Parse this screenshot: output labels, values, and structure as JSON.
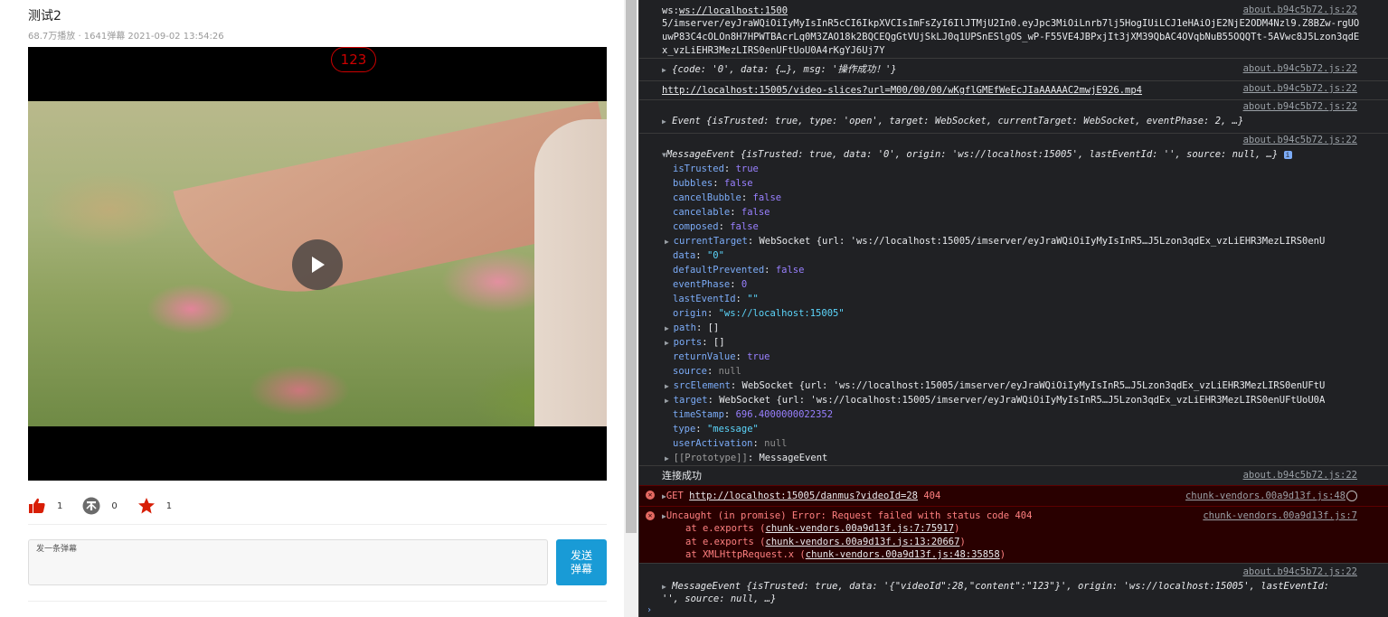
{
  "video_page": {
    "title": "测试2",
    "meta": "68.7万播放 · 1641弹幕 2021-09-02 13:54:26",
    "danmu_text": "123",
    "actions": {
      "like_count": "1",
      "dislike_count": "0",
      "star_count": "1"
    },
    "danmu_input": {
      "placeholder": "发一条弹幕"
    },
    "send_label": "发送\n弹幕"
  },
  "console": {
    "ws_url_line1": "ws://localhost:1500",
    "ws_url_rest": "5/imserver/eyJraWQiOiIyMyIsInR5cCI6IkpXVCIsImFsZyI6IlJTMjU2In0.eyJpc3MiOiLnrb7lj5HogIUiLCJ1eHAiOjE2NjE2ODM4Nzl9.Z8BZw-rgUOuwP83C4cOLOn8H7HPWTBAcrLq0M3ZAO18k2BQCEQgGtVUjSkLJ0q1UPSnESlgOS_wP-F55VE4JBPxjIt3jXM39QbAC4OVqbNuB55OQQTt-5AVwc8J5Lzon3qdEx_vzLiEHR3MezLIRS0enUFtUoU0A4rKgYJ6Uj7Y",
    "ws_source": "about.b94c5b72.js:22",
    "result_obj": "{code: '0', data: {…}, msg: '操作成功！'}",
    "result_source": "about.b94c5b72.js:22",
    "video_url": "http://localhost:15005/video-slices?url=M00/00/00/wKgflGMEfWeEcJIaAAAAAC2mwjE926.mp4",
    "video_source": "about.b94c5b72.js:22",
    "event_open": "Event {isTrusted: true, type: 'open', target: WebSocket, currentTarget: WebSocket, eventPhase: 2, …}",
    "event_source": "about.b94c5b72.js:22",
    "msgevent_header": "MessageEvent {isTrusted: true, data: '0', origin: 'ws://localhost:15005', lastEventId: '', source: null, …}",
    "msgevent_source": "about.b94c5b72.js:22",
    "props": [
      {
        "key": "isTrusted",
        "value": "true",
        "kind": "bool"
      },
      {
        "key": "bubbles",
        "value": "false",
        "kind": "bool"
      },
      {
        "key": "cancelBubble",
        "value": "false",
        "kind": "bool"
      },
      {
        "key": "cancelable",
        "value": "false",
        "kind": "bool"
      },
      {
        "key": "composed",
        "value": "false",
        "kind": "bool"
      },
      {
        "key": "currentTarget",
        "value": "WebSocket {url: 'ws://localhost:15005/imserver/eyJraWQiOiIyMyIsInR5…J5Lzon3qdEx_vzLiEHR3MezLIRS0enU",
        "kind": "obj"
      },
      {
        "key": "data",
        "value": "\"0\"",
        "kind": "str"
      },
      {
        "key": "defaultPrevented",
        "value": "false",
        "kind": "bool"
      },
      {
        "key": "eventPhase",
        "value": "0",
        "kind": "num"
      },
      {
        "key": "lastEventId",
        "value": "\"\"",
        "kind": "str"
      },
      {
        "key": "origin",
        "value": "\"ws://localhost:15005\"",
        "kind": "str"
      },
      {
        "key": "path",
        "value": "[]",
        "kind": "obj"
      },
      {
        "key": "ports",
        "value": "[]",
        "kind": "obj"
      },
      {
        "key": "returnValue",
        "value": "true",
        "kind": "bool"
      },
      {
        "key": "source",
        "value": "null",
        "kind": "null"
      },
      {
        "key": "srcElement",
        "value": "WebSocket {url: 'ws://localhost:15005/imserver/eyJraWQiOiIyMyIsInR5…J5Lzon3qdEx_vzLiEHR3MezLIRS0enUFtU",
        "kind": "obj"
      },
      {
        "key": "target",
        "value": "WebSocket {url: 'ws://localhost:15005/imserver/eyJraWQiOiIyMyIsInR5…J5Lzon3qdEx_vzLiEHR3MezLIRS0enUFtUoU0A",
        "kind": "obj"
      },
      {
        "key": "timeStamp",
        "value": "696.4000000022352",
        "kind": "num"
      },
      {
        "key": "type",
        "value": "\"message\"",
        "kind": "str"
      },
      {
        "key": "userActivation",
        "value": "null",
        "kind": "null"
      },
      {
        "key": "[[Prototype]]",
        "value": "MessageEvent",
        "kind": "obj"
      }
    ],
    "connected_text": "连接成功",
    "connected_source": "about.b94c5b72.js:22",
    "get_error": {
      "method": "GET",
      "url": "http://localhost:15005/danmus?videoId=28",
      "status": "404",
      "source": "chunk-vendors.00a9d13f.js:48"
    },
    "uncaught_error": {
      "message": "Uncaught (in promise) Error: Request failed with status code 404",
      "source": "chunk-vendors.00a9d13f.js:7",
      "stack": [
        {
          "prefix": "at e.exports (",
          "loc": "chunk-vendors.00a9d13f.js:7:75917",
          "suffix": ")"
        },
        {
          "prefix": "at e.exports (",
          "loc": "chunk-vendors.00a9d13f.js:13:20667",
          "suffix": ")"
        },
        {
          "prefix": "at XMLHttpRequest.x (",
          "loc": "chunk-vendors.00a9d13f.js:48:35858",
          "suffix": ")"
        }
      ]
    },
    "last_msg_line1": "MessageEvent {isTrusted: true, data: '{\"videoId\":28,\"content\":\"123\"}', origin: 'ws://localhost:15005', lastEventId:",
    "last_msg_line2": "'', source: null, …}",
    "last_source": "about.b94c5b72.js:22"
  }
}
